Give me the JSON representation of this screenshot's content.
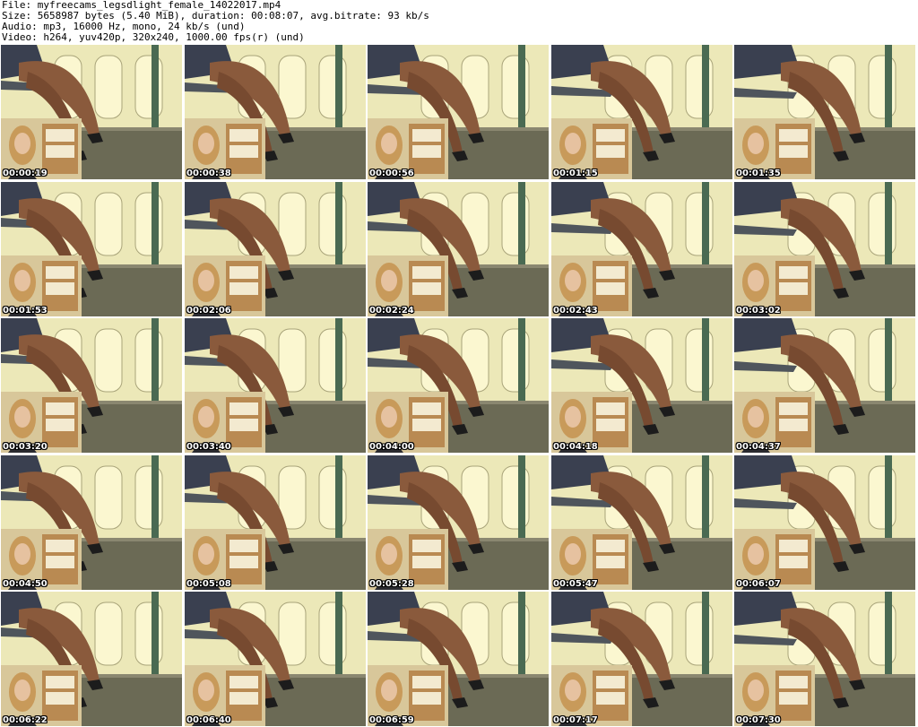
{
  "header": {
    "file_line": "File: myfreecams_legsdlight_female_14022017.mp4",
    "size_line": "Size: 5658987 bytes (5.40 MiB), duration: 00:08:07, avg.bitrate: 93 kb/s",
    "audio_line": "Audio: mp3, 16000 Hz, mono, 24 kb/s (und)",
    "video_line": "Video: h264, yuv420p, 320x240, 1000.00 fps(r) (und)"
  },
  "thumbnails": [
    {
      "timestamp": "00:00:19"
    },
    {
      "timestamp": "00:00:38"
    },
    {
      "timestamp": "00:00:56"
    },
    {
      "timestamp": "00:01:15"
    },
    {
      "timestamp": "00:01:35"
    },
    {
      "timestamp": "00:01:53"
    },
    {
      "timestamp": "00:02:06"
    },
    {
      "timestamp": "00:02:24"
    },
    {
      "timestamp": "00:02:43"
    },
    {
      "timestamp": "00:03:02"
    },
    {
      "timestamp": "00:03:20"
    },
    {
      "timestamp": "00:03:40"
    },
    {
      "timestamp": "00:04:00"
    },
    {
      "timestamp": "00:04:18"
    },
    {
      "timestamp": "00:04:37"
    },
    {
      "timestamp": "00:04:50"
    },
    {
      "timestamp": "00:05:08"
    },
    {
      "timestamp": "00:05:28"
    },
    {
      "timestamp": "00:05:47"
    },
    {
      "timestamp": "00:06:07"
    },
    {
      "timestamp": "00:06:22"
    },
    {
      "timestamp": "00:06:40"
    },
    {
      "timestamp": "00:06:59"
    },
    {
      "timestamp": "00:07:17"
    },
    {
      "timestamp": "00:07:30"
    }
  ],
  "colors": {
    "page_background": "#ffffff",
    "header_text": "#000000",
    "timestamp_text": "#ffffff",
    "timestamp_outline": "#000000",
    "room_wall": "#ece8b8",
    "room_floor": "#6b6a55",
    "skin_tone": "#8a5a3c",
    "dress": "#3a4050",
    "hair": "#c89a5a",
    "shelf": "#b98a52"
  }
}
